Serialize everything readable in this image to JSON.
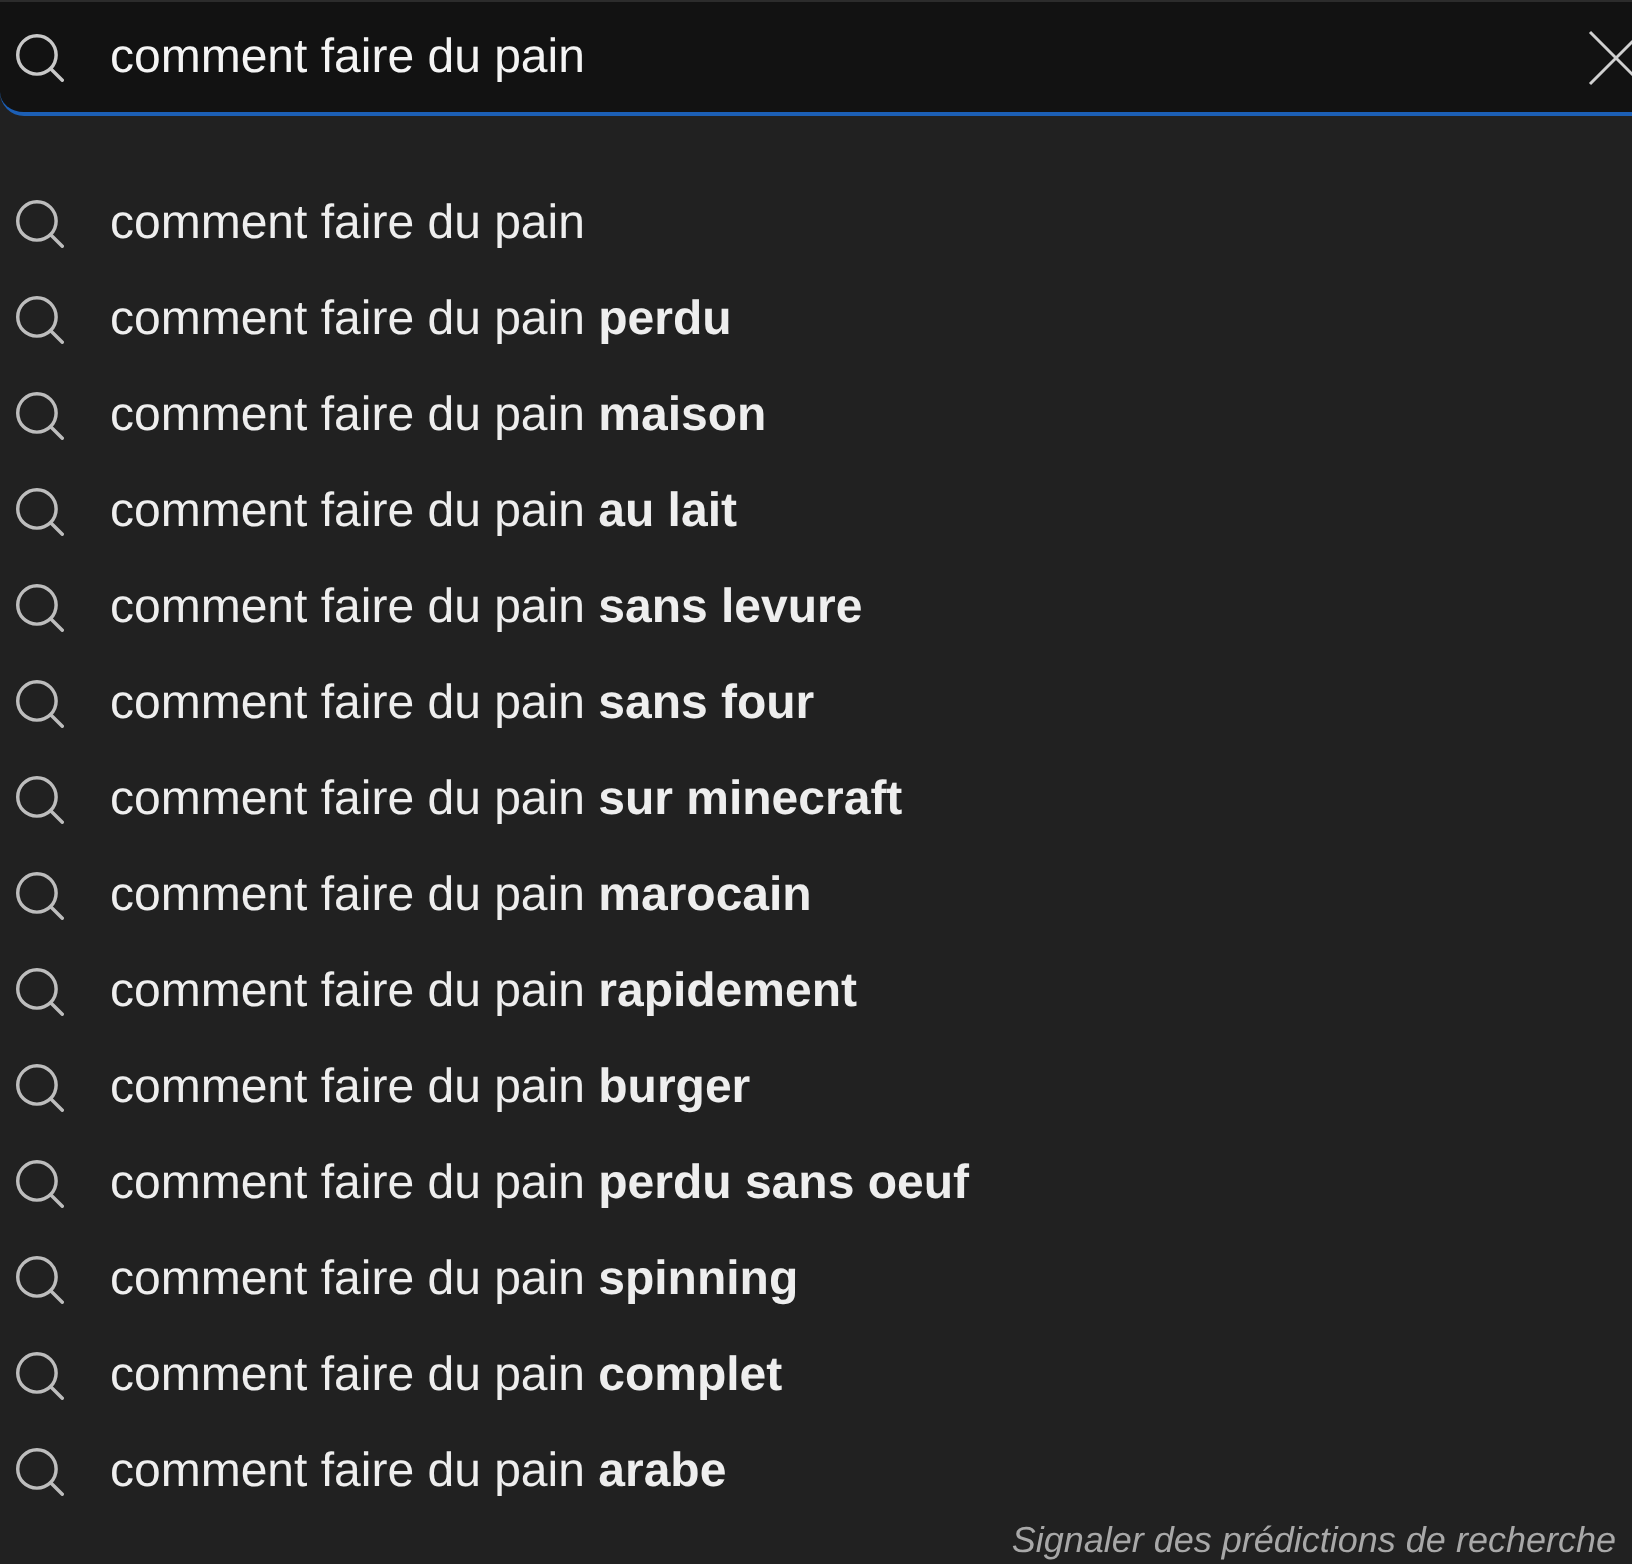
{
  "search": {
    "value": "comment faire du pain"
  },
  "suggestions": [
    "comment faire du pain",
    "comment faire du pain **perdu**",
    "comment faire du pain **maison**",
    "comment faire du pain **au lait**",
    "comment faire du pain **sans levure**",
    "comment faire du pain **sans four**",
    "comment faire du pain **sur minecraft**",
    "comment faire du pain **marocain**",
    "comment faire du pain **rapidement**",
    "comment faire du pain **burger**",
    "comment faire du pain **perdu sans oeuf**",
    "comment faire du pain **spinning**",
    "comment faire du pain **complet**",
    "comment faire du pain **arabe**"
  ],
  "footer": {
    "link": "Signaler des prédictions de recherche"
  }
}
